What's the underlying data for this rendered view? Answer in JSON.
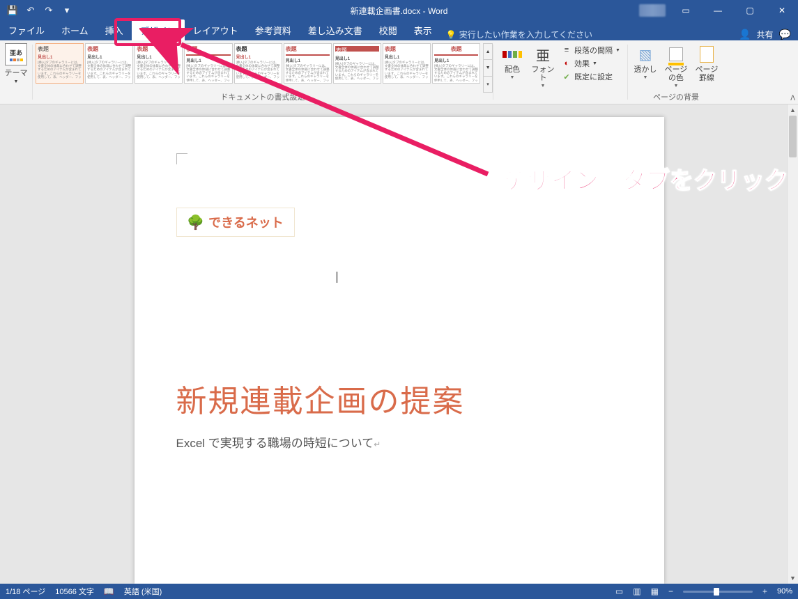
{
  "titlebar": {
    "title": "新連載企画書.docx - Word"
  },
  "tabs": {
    "file": "ファイル",
    "home": "ホーム",
    "insert": "挿入",
    "design": "デザイン",
    "layout": "レイアウト",
    "references": "参考資料",
    "mailings": "差し込み文書",
    "review": "校閲",
    "view": "表示",
    "tellme_icon": "♀",
    "tellme": "実行したい作業を入力してください",
    "share_icon": "👤",
    "share": "共有"
  },
  "ribbon": {
    "themes_label": "テーマ",
    "themes_aa": "亜あ",
    "styleset_title": "表題",
    "styleset_sub": "見出し1",
    "styleset_filler": "[挿入]タブのギャラリーには、文書全体の体裁に合わせて調整するためのアイテムが含まれています。これらのギャラリーを使用して、表、ヘッダー、フッ",
    "gallery_group": "ドキュメントの書式設定",
    "colors": "配色",
    "fonts": "フォント",
    "para_spacing": "段落の間隔",
    "effects": "効果",
    "set_default": "既定に設定",
    "watermark": "透かし",
    "page_color": "ページの色",
    "page_borders": "ページ罫線",
    "page_bg_group": "ページの背景"
  },
  "document": {
    "logo_text": "できるネット",
    "title": "新規連載企画の提案",
    "subtitle": "Excel で実現する職場の時短について"
  },
  "annotation": {
    "text": "［デザイン］タブをクリック"
  },
  "status": {
    "page": "1/18 ページ",
    "words": "10566 文字",
    "lang": "英語 (米国)",
    "zoom": "90%"
  }
}
